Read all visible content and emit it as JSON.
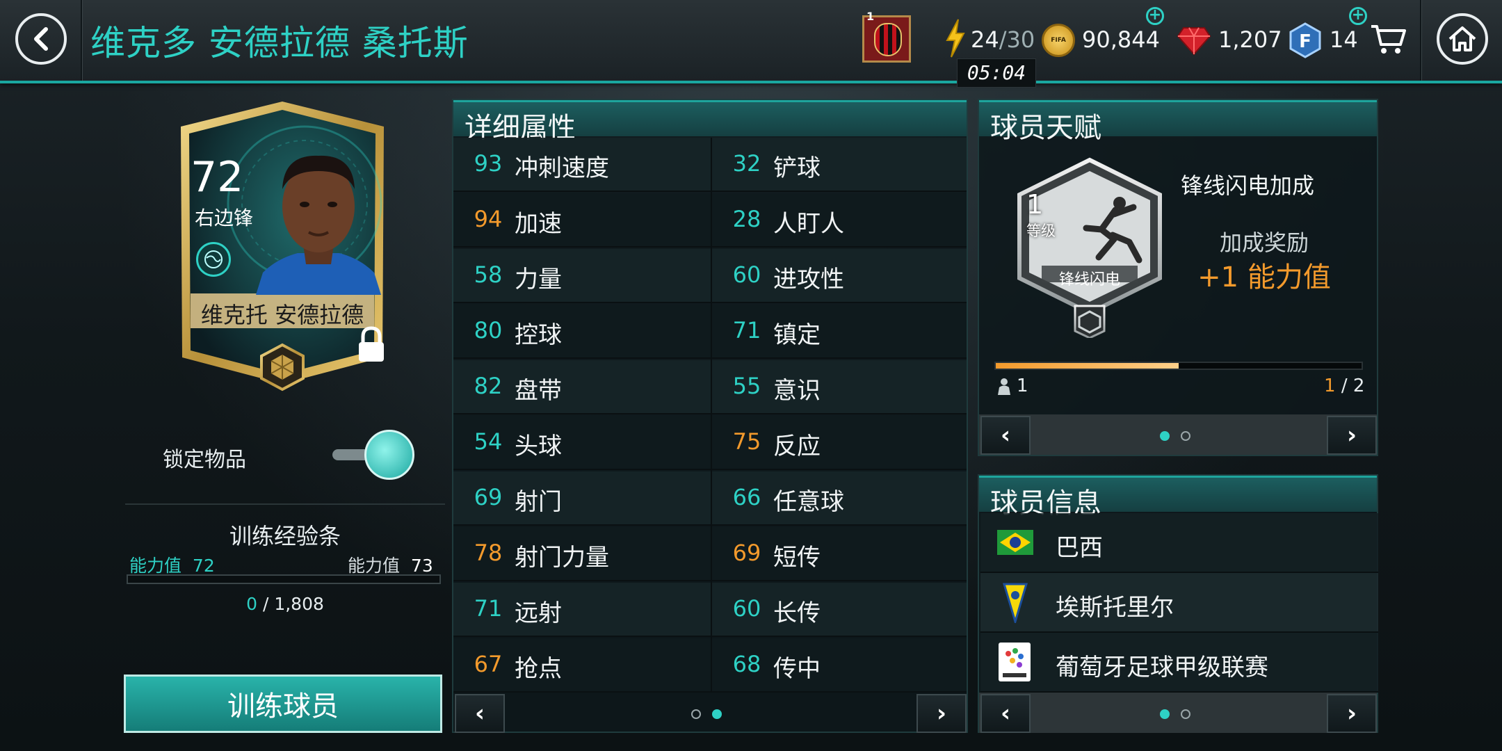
{
  "topbar": {
    "title": "维克多 安德拉德 桑托斯",
    "badge_count": "1",
    "energy": "24",
    "energy_max": "/30",
    "timer": "05:04",
    "coins": "90,844",
    "gems": "1,207",
    "fifa_points": "14",
    "icons": [
      "back-icon",
      "club-badge-icon",
      "lightning-icon",
      "fifa-coin-icon",
      "gem-icon",
      "f-points-icon",
      "cart-icon",
      "home-icon"
    ]
  },
  "card": {
    "rating": "72",
    "position": "右边锋",
    "name": "维克托 安德拉德"
  },
  "lock": {
    "label": "锁定物品",
    "state": "on"
  },
  "training": {
    "title": "训练经验条",
    "left_label": "能力值",
    "left_value": "72",
    "right_label": "能力值",
    "right_value": "73",
    "progress_current": "0",
    "progress_sep": "/",
    "progress_total": "1,808",
    "progress_fraction": 0.0,
    "button_label": "训练球员"
  },
  "attributes": {
    "title": "详细属性",
    "left": [
      {
        "value": "93",
        "name": "冲刺速度",
        "color": "teal"
      },
      {
        "value": "94",
        "name": "加速",
        "color": "orange"
      },
      {
        "value": "58",
        "name": "力量",
        "color": "teal"
      },
      {
        "value": "80",
        "name": "控球",
        "color": "teal"
      },
      {
        "value": "82",
        "name": "盘带",
        "color": "teal"
      },
      {
        "value": "54",
        "name": "头球",
        "color": "teal"
      },
      {
        "value": "69",
        "name": "射门",
        "color": "teal"
      },
      {
        "value": "78",
        "name": "射门力量",
        "color": "orange"
      },
      {
        "value": "71",
        "name": "远射",
        "color": "teal"
      },
      {
        "value": "67",
        "name": "抢点",
        "color": "orange"
      }
    ],
    "right": [
      {
        "value": "32",
        "name": "铲球",
        "color": "teal"
      },
      {
        "value": "28",
        "name": "人盯人",
        "color": "teal"
      },
      {
        "value": "60",
        "name": "进攻性",
        "color": "teal"
      },
      {
        "value": "71",
        "name": "镇定",
        "color": "teal"
      },
      {
        "value": "55",
        "name": "意识",
        "color": "teal"
      },
      {
        "value": "75",
        "name": "反应",
        "color": "orange"
      },
      {
        "value": "66",
        "name": "任意球",
        "color": "teal"
      },
      {
        "value": "69",
        "name": "短传",
        "color": "orange"
      },
      {
        "value": "60",
        "name": "长传",
        "color": "teal"
      },
      {
        "value": "68",
        "name": "传中",
        "color": "teal"
      }
    ],
    "page": 2,
    "pages": 2
  },
  "talent": {
    "title": "球员天赋",
    "level_number": "1",
    "level_label": "等级",
    "badge_name": "锋线闪电",
    "talent_name": "锋线闪电加成",
    "bonus_label": "加成奖励",
    "bonus_value": "+1 能力值",
    "progress_fraction": 0.5,
    "players_count": "1",
    "step_current": "1",
    "step_sep": "/ 2",
    "page": 1,
    "pages": 2
  },
  "info": {
    "title": "球员信息",
    "nation": "巴西",
    "club": "埃斯托里尔",
    "league": "葡萄牙足球甲级联赛",
    "page": 1,
    "pages": 2
  },
  "colors": {
    "teal": "#2ed1c5",
    "orange": "#f39a2c",
    "gold": "#c9a24a"
  }
}
